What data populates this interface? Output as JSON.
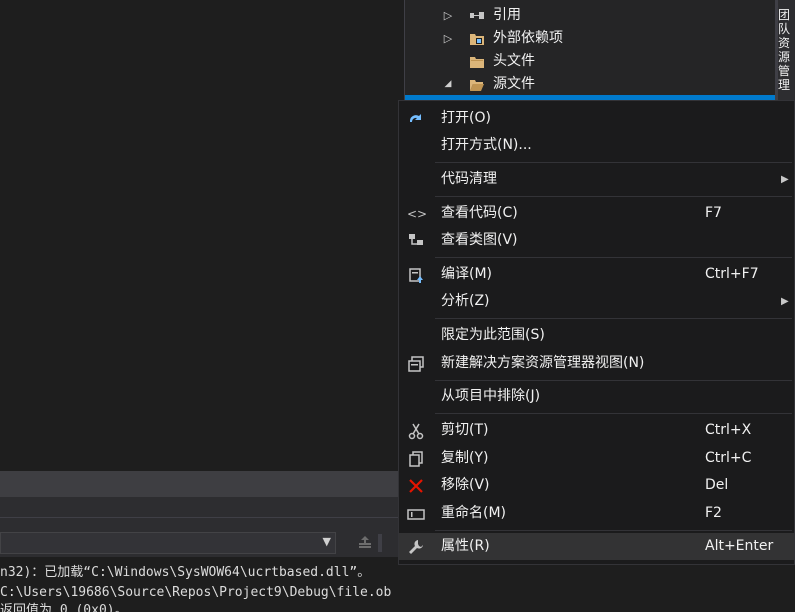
{
  "solution_explorer": {
    "items": [
      {
        "label": "引用",
        "arrow": "▷",
        "icon": "references-icon"
      },
      {
        "label": "外部依赖项",
        "arrow": "▷",
        "icon": "external-deps-folder-icon"
      },
      {
        "label": "头文件",
        "arrow": "",
        "icon": "folder-icon"
      },
      {
        "label": "源文件",
        "arrow": "◢",
        "icon": "folder-open-icon"
      }
    ]
  },
  "side_tab": {
    "label": "团队资源管理"
  },
  "output": {
    "lines": [
      "n32)：已加载“C:\\Windows\\SysWOW64\\ucrtbased.dll”。",
      "C:\\Users\\19686\\Source\\Repos\\Project9\\Debug\\file.ob",
      " 返回值为 0 (0x0)。"
    ]
  },
  "context_menu": {
    "items": [
      {
        "label": "打开(O)",
        "shortcut": "",
        "submenu": false,
        "icon": "open-arrow-icon"
      },
      {
        "label": "打开方式(N)...",
        "shortcut": "",
        "submenu": false,
        "icon": ""
      },
      {
        "label": "代码清理",
        "shortcut": "",
        "submenu": true,
        "icon": ""
      },
      {
        "label": "查看代码(C)",
        "shortcut": "F7",
        "submenu": false,
        "icon": "code-brackets-icon"
      },
      {
        "label": "查看类图(V)",
        "shortcut": "",
        "submenu": false,
        "icon": "class-diagram-icon"
      },
      {
        "label": "编译(M)",
        "shortcut": "Ctrl+F7",
        "submenu": false,
        "icon": "compile-icon"
      },
      {
        "label": "分析(Z)",
        "shortcut": "",
        "submenu": true,
        "icon": ""
      },
      {
        "label": "限定为此范围(S)",
        "shortcut": "",
        "submenu": false,
        "icon": ""
      },
      {
        "label": "新建解决方案资源管理器视图(N)",
        "shortcut": "",
        "submenu": false,
        "icon": "new-view-icon"
      },
      {
        "label": "从项目中排除(J)",
        "shortcut": "",
        "submenu": false,
        "icon": ""
      },
      {
        "label": "剪切(T)",
        "shortcut": "Ctrl+X",
        "submenu": false,
        "icon": "scissors-icon"
      },
      {
        "label": "复制(Y)",
        "shortcut": "Ctrl+C",
        "submenu": false,
        "icon": "copy-icon"
      },
      {
        "label": "移除(V)",
        "shortcut": "Del",
        "submenu": false,
        "icon": "remove-x-icon"
      },
      {
        "label": "重命名(M)",
        "shortcut": "F2",
        "submenu": false,
        "icon": "rename-icon"
      },
      {
        "label": "属性(R)",
        "shortcut": "Alt+Enter",
        "submenu": false,
        "icon": "wrench-icon"
      }
    ]
  },
  "colors": {
    "accent": "#007acc",
    "remove_red": "#e51400",
    "open_blue": "#75beff",
    "folder_yellow": "#dcb67a"
  }
}
